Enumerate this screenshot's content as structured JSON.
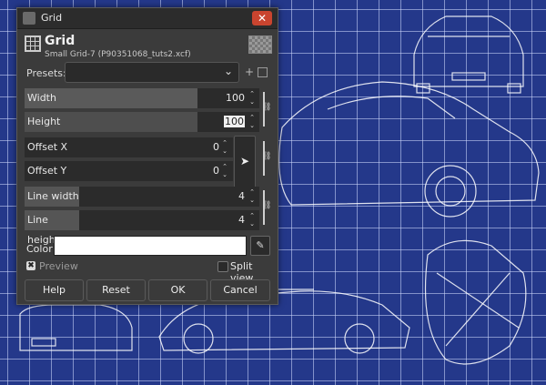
{
  "window": {
    "title": "Grid",
    "close_glyph": "✕"
  },
  "header": {
    "title": "Grid",
    "subtitle": "Small Grid-7 (P90351068_tuts2.xcf)",
    "icon": "grid-icon"
  },
  "presets": {
    "label": "Presets:",
    "value": "",
    "add_glyph": "+"
  },
  "fields": {
    "width": {
      "label": "Width",
      "value": "100"
    },
    "height": {
      "label": "Height",
      "value": "100"
    },
    "offset_x": {
      "label": "Offset X",
      "value": "0"
    },
    "offset_y": {
      "label": "Offset Y",
      "value": "0"
    },
    "line_width": {
      "label": "Line width",
      "value": "4"
    },
    "line_height": {
      "label": "Line height",
      "value": "4"
    }
  },
  "color": {
    "label": "Color",
    "value": "#ffffff"
  },
  "options": {
    "preview": {
      "label": "Preview",
      "checked": true
    },
    "split_view": {
      "label": "Split view",
      "checked": false
    }
  },
  "buttons": {
    "help": "Help",
    "reset": "Reset",
    "ok": "OK",
    "cancel": "Cancel"
  }
}
